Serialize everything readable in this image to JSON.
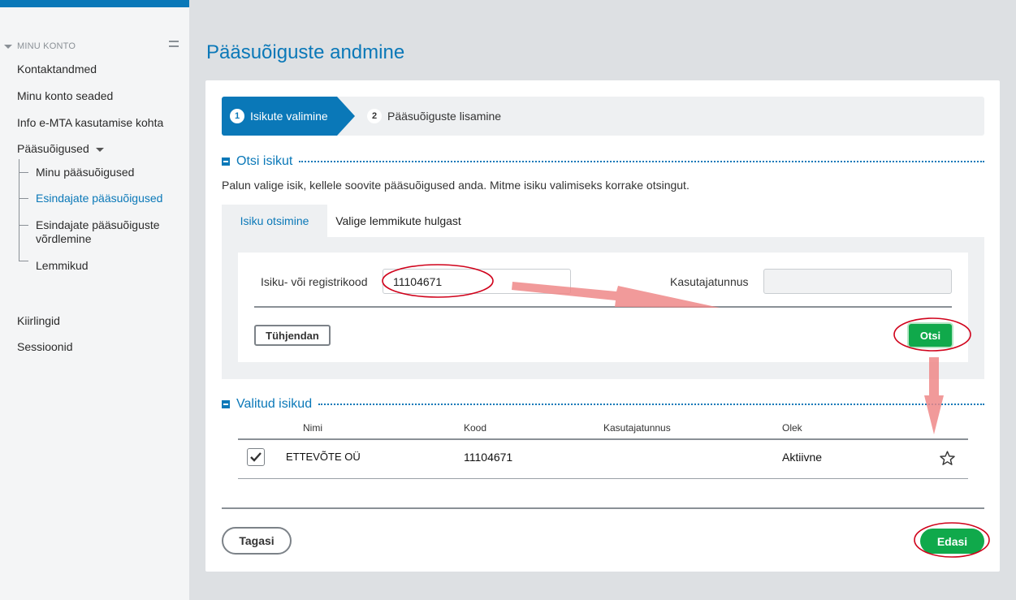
{
  "sidebar": {
    "header": "MINU KONTO",
    "items": [
      {
        "label": "Kontaktandmed"
      },
      {
        "label": "Minu konto seaded"
      },
      {
        "label": "Info e-MTA kasutamise kohta"
      },
      {
        "label": "Pääsuõigused"
      },
      {
        "label": "Minu pääsuõigused"
      },
      {
        "label": "Esindajate pääsuõigused"
      },
      {
        "label": "Esindajate pääsuõiguste võrdlemine"
      },
      {
        "label": "Lemmikud"
      },
      {
        "label": "Kiirlingid"
      },
      {
        "label": "Sessioonid"
      }
    ]
  },
  "page": {
    "title": "Pääsuõiguste andmine"
  },
  "stepper": {
    "step1": {
      "num": "1",
      "label": "Isikute valimine"
    },
    "step2": {
      "num": "2",
      "label": "Pääsuõiguste lisamine"
    }
  },
  "search_section": {
    "title": "Otsi isikut",
    "info": "Palun valige isik, kellele soovite pääsuõigused anda. Mitme isiku valimiseks korrake otsingut.",
    "tabs": [
      "Isiku otsimine",
      "Valige lemmikute hulgast"
    ],
    "code_label": "Isiku- või registrikood",
    "code_value": "11104671",
    "user_label": "Kasutajatunnus",
    "user_value": "",
    "clear_label": "Tühjendan",
    "search_label": "Otsi"
  },
  "selected_section": {
    "title": "Valitud isikud",
    "columns": [
      "Nimi",
      "Kood",
      "Kasutajatunnus",
      "Olek"
    ],
    "rows": [
      {
        "name": "ETTEVÕTE OÜ",
        "code": "11104671",
        "user": "",
        "status": "Aktiivne"
      }
    ]
  },
  "footer": {
    "back_label": "Tagasi",
    "next_label": "Edasi"
  },
  "colors": {
    "accent": "#0a78b8",
    "success": "#10a94b",
    "annotation": "#d0021b"
  }
}
